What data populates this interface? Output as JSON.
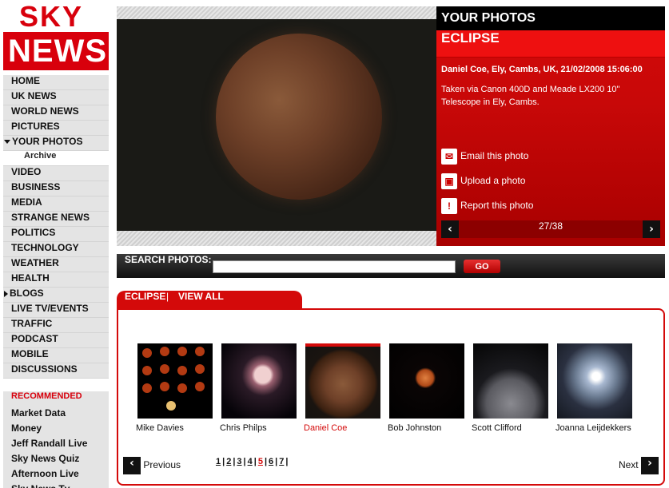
{
  "logo": {
    "top": "SKY",
    "bottom": "NEWS"
  },
  "nav": [
    {
      "label": "HOME"
    },
    {
      "label": "UK NEWS"
    },
    {
      "label": "WORLD NEWS"
    },
    {
      "label": "PICTURES"
    },
    {
      "label": "YOUR PHOTOS",
      "expanded": true
    },
    {
      "label": "Archive",
      "sub": true
    },
    {
      "label": "VIDEO"
    },
    {
      "label": "BUSINESS"
    },
    {
      "label": "MEDIA"
    },
    {
      "label": "STRANGE NEWS"
    },
    {
      "label": "POLITICS"
    },
    {
      "label": "TECHNOLOGY"
    },
    {
      "label": "WEATHER"
    },
    {
      "label": "HEALTH"
    },
    {
      "label": "BLOGS",
      "collapsed": true
    },
    {
      "label": "LIVE TV/EVENTS"
    },
    {
      "label": "TRAFFIC"
    },
    {
      "label": "PODCAST"
    },
    {
      "label": "MOBILE"
    },
    {
      "label": "DISCUSSIONS"
    }
  ],
  "recommended": {
    "title": "RECOMMENDED",
    "items": [
      "Market Data",
      "Money",
      "Jeff Randall Live",
      "Sky News Quiz",
      "Afternoon Live",
      "Sky News Tv"
    ]
  },
  "info": {
    "header": "YOUR PHOTOS",
    "title": "ECLIPSE",
    "meta": "Daniel Coe, Ely, Cambs, UK, 21/02/2008 15:06:00",
    "description": "Taken via Canon 400D and Meade LX200 10\" Telescope in Ely, Cambs.",
    "actions": {
      "email": "Email this photo",
      "upload": "Upload a photo",
      "report": "Report this photo"
    },
    "counter": "27/38"
  },
  "search": {
    "label": "SEARCH PHOTOS:",
    "value": "",
    "button": "GO"
  },
  "gallery": {
    "tab": "ECLIPSE",
    "view_all": "VIEW ALL",
    "thumbs": [
      {
        "name": "Mike Davies",
        "icon": "moon-phases-grid"
      },
      {
        "name": "Chris Philps",
        "icon": "pink-moon"
      },
      {
        "name": "Daniel Coe",
        "icon": "copper-moon",
        "selected": true
      },
      {
        "name": "Bob Johnston",
        "icon": "small-orange-moon"
      },
      {
        "name": "Scott Clifford",
        "icon": "grey-moon"
      },
      {
        "name": "Joanna Leijdekkers",
        "icon": "halo-moon"
      }
    ],
    "previous": "Previous",
    "next": "Next",
    "pages": [
      "1",
      "2",
      "3",
      "4",
      "5",
      "6",
      "7"
    ],
    "current_page": "5"
  },
  "colors": {
    "accent": "#d40a0a",
    "dark": "#111111"
  }
}
